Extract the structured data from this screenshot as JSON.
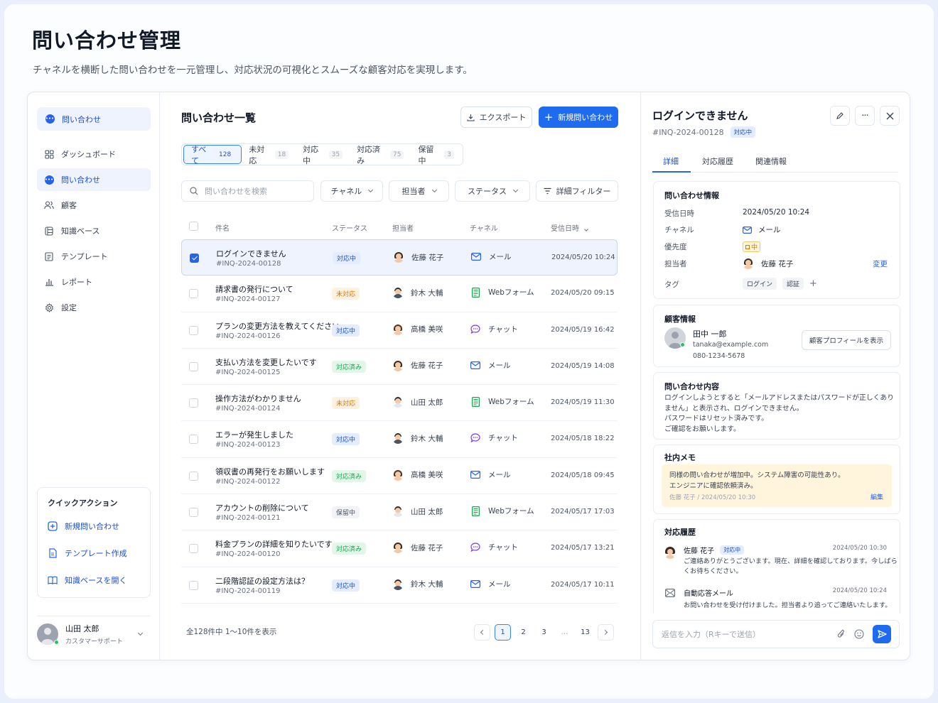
{
  "page": {
    "title": "問い合わせ管理",
    "subtitle": "チャネルを横断した問い合わせを一元管理し、対応状況の可視化とスムーズな顧客対応を実現します。"
  },
  "sidebar": {
    "top_label": "問い合わせ",
    "items": [
      {
        "label": "ダッシュボード",
        "icon": "dashboard-icon"
      },
      {
        "label": "問い合わせ",
        "icon": "chat-bubble-icon",
        "active": true
      },
      {
        "label": "顧客",
        "icon": "users-icon"
      },
      {
        "label": "知識ベース",
        "icon": "database-icon"
      },
      {
        "label": "テンプレート",
        "icon": "document-icon"
      },
      {
        "label": "レポート",
        "icon": "bar-chart-icon"
      },
      {
        "label": "設定",
        "icon": "gear-icon"
      }
    ],
    "quick_actions": {
      "title": "クイックアクション",
      "items": [
        {
          "label": "新規問い合わせ",
          "icon": "plus-circle-icon"
        },
        {
          "label": "テンプレート作成",
          "icon": "document-icon"
        },
        {
          "label": "知識ベースを開く",
          "icon": "book-icon"
        }
      ]
    },
    "user": {
      "name": "山田 太郎",
      "role": "カスタマーサポート"
    }
  },
  "list": {
    "title": "問い合わせ一覧",
    "export_label": "エクスポート",
    "new_label": "新規問い合わせ",
    "tabs": [
      {
        "label": "すべて",
        "count": "128",
        "active": true
      },
      {
        "label": "未対応",
        "count": "18"
      },
      {
        "label": "対応中",
        "count": "35"
      },
      {
        "label": "対応済み",
        "count": "75"
      },
      {
        "label": "保留中",
        "count": "3"
      }
    ],
    "search_placeholder": "問い合わせを検索",
    "filters": {
      "channel": "チャネル",
      "assignee": "担当者",
      "status": "ステータス",
      "advanced": "詳細フィルター"
    },
    "columns": {
      "subject": "件名",
      "status": "ステータス",
      "assignee": "担当者",
      "channel": "チャネル",
      "received": "受信日時"
    },
    "rows": [
      {
        "subject": "ログインできません",
        "id": "#INQ-2024-00128",
        "status": "対応中",
        "status_type": "prog",
        "assignee": "佐藤 花子",
        "avatar": "f",
        "channel": "メール",
        "channel_type": "mail",
        "date": "2024/05/20 10:24",
        "selected": true
      },
      {
        "subject": "請求書の発行について",
        "id": "#INQ-2024-00127",
        "status": "未対応",
        "status_type": "new",
        "assignee": "鈴木 大輔",
        "avatar": "m",
        "channel": "Webフォーム",
        "channel_type": "form",
        "date": "2024/05/20 09:15"
      },
      {
        "subject": "プランの変更方法を教えてください",
        "id": "#INQ-2024-00126",
        "status": "対応中",
        "status_type": "prog",
        "assignee": "高橋 美咲",
        "avatar": "f2",
        "channel": "チャット",
        "channel_type": "chat",
        "date": "2024/05/19 16:42"
      },
      {
        "subject": "支払い方法を変更したいです",
        "id": "#INQ-2024-00125",
        "status": "対応済み",
        "status_type": "done",
        "assignee": "佐藤 花子",
        "avatar": "f",
        "channel": "メール",
        "channel_type": "mail",
        "date": "2024/05/19 14:08"
      },
      {
        "subject": "操作方法がわかりません",
        "id": "#INQ-2024-00124",
        "status": "未対応",
        "status_type": "new",
        "assignee": "山田 太郎",
        "avatar": "m2",
        "channel": "Webフォーム",
        "channel_type": "form",
        "date": "2024/05/19 11:30"
      },
      {
        "subject": "エラーが発生しました",
        "id": "#INQ-2024-00123",
        "status": "対応中",
        "status_type": "prog",
        "assignee": "鈴木 大輔",
        "avatar": "m",
        "channel": "チャット",
        "channel_type": "chat",
        "date": "2024/05/18 18:22"
      },
      {
        "subject": "領収書の再発行をお願いします",
        "id": "#INQ-2024-00122",
        "status": "対応済み",
        "status_type": "done",
        "assignee": "高橋 美咲",
        "avatar": "f2",
        "channel": "メール",
        "channel_type": "mail",
        "date": "2024/05/18 09:45"
      },
      {
        "subject": "アカウントの削除について",
        "id": "#INQ-2024-00121",
        "status": "保留中",
        "status_type": "hold",
        "assignee": "山田 太郎",
        "avatar": "m2",
        "channel": "Webフォーム",
        "channel_type": "form",
        "date": "2024/05/17 17:03"
      },
      {
        "subject": "料金プランの詳細を知りたいです",
        "id": "#INQ-2024-00120",
        "status": "対応済み",
        "status_type": "done",
        "assignee": "佐藤 花子",
        "avatar": "f",
        "channel": "チャット",
        "channel_type": "chat",
        "date": "2024/05/17 13:21"
      },
      {
        "subject": "二段階認証の設定方法は？",
        "id": "#INQ-2024-00119",
        "status": "対応中",
        "status_type": "prog",
        "assignee": "鈴木 大輔",
        "avatar": "m",
        "channel": "メール",
        "channel_type": "mail",
        "date": "2024/05/17 10:11"
      }
    ],
    "footer": "全128件中 1〜10件を表示",
    "pagination": {
      "pages": [
        "1",
        "2",
        "3",
        "…",
        "13"
      ],
      "current": "1"
    }
  },
  "detail": {
    "title": "ログインできません",
    "id": "#INQ-2024-00128",
    "status": "対応中",
    "tabs": [
      "詳細",
      "対応履歴",
      "関連情報"
    ],
    "info": {
      "title": "問い合わせ情報",
      "received_label": "受信日時",
      "received": "2024/05/20 10:24",
      "channel_label": "チャネル",
      "channel": "メール",
      "priority_label": "優先度",
      "priority": "中",
      "assignee_label": "担当者",
      "assignee": "佐藤 花子",
      "change_label": "変更",
      "tags_label": "タグ",
      "tags": [
        "ログイン",
        "認証"
      ]
    },
    "customer": {
      "title": "顧客情報",
      "name": "田中 一郎",
      "email": "tanaka@example.com",
      "phone": "080-1234-5678",
      "profile_button": "顧客プロフィールを表示"
    },
    "content": {
      "title": "問い合わせ内容",
      "lines": [
        "ログインしようとすると「メールアドレスまたはパスワードが正しくあり",
        "ません」と表示され、ログインできません。",
        "パスワードはリセット済みです。",
        "ご確認をお願いします。"
      ]
    },
    "memo": {
      "title": "社内メモ",
      "lines": [
        "同様の問い合わせが増加中。システム障害の可能性あり。",
        "エンジニアに確認依頼済み。"
      ],
      "meta": "佐藤 花子 / 2024/05/20 10:30",
      "edit_label": "編集"
    },
    "history": {
      "title": "対応履歴",
      "items": [
        {
          "name": "佐藤 花子",
          "badge": "対応中",
          "time": "2024/05/20 10:30",
          "lines": [
            "ご連絡ありがとうございます。現在、詳細を確認しております。今しばら",
            "くお待ちください。"
          ]
        },
        {
          "name": "自動応答メール",
          "time": "2024/05/20 10:24",
          "lines": [
            "お問い合わせを受け付けました。担当者より追ってご連絡いたします。"
          ]
        }
      ]
    },
    "reply_placeholder": "返信を入力（Rキーで送信）"
  }
}
